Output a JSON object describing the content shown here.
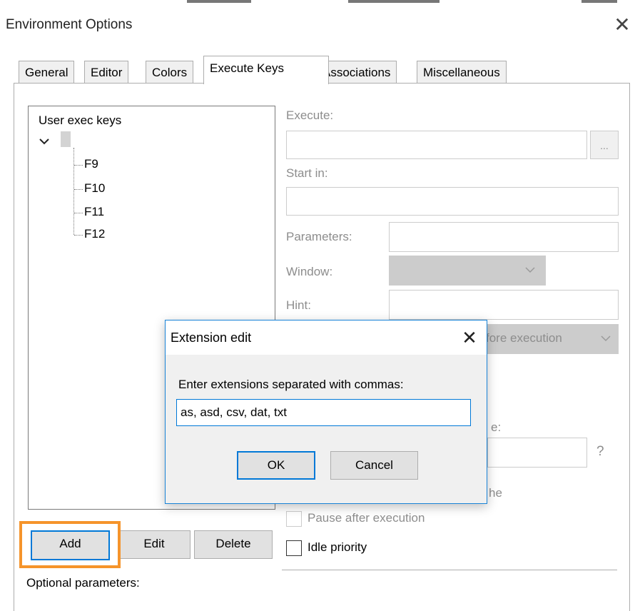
{
  "window": {
    "title": "Environment Options",
    "close_glyph": "✕"
  },
  "tabs": [
    {
      "label": "General",
      "active": false
    },
    {
      "label": "Editor",
      "active": false
    },
    {
      "label": "Colors",
      "active": false
    },
    {
      "label": "Execute Keys",
      "active": true
    },
    {
      "label": "Associations",
      "active": false
    },
    {
      "label": "Miscellaneous",
      "active": false
    }
  ],
  "tree": {
    "header": "User exec keys",
    "expander_icon": "chevron-down-icon",
    "root_label": "",
    "items": [
      "F9",
      "F10",
      "F11",
      "F12"
    ]
  },
  "execute_panel": {
    "execute_label": "Execute:",
    "browse_label": "...",
    "start_in_label": "Start in:",
    "parameters_label": "Parameters:",
    "window_label": "Window:",
    "hint_label": "Hint:",
    "behind_dialog_combo_text": "fore execution",
    "behind_dialog_label_2": "e:",
    "help_glyph": "?",
    "behind_dialog_label_3": "he",
    "pause_label": "Pause after execution",
    "idle_label": "Idle priority"
  },
  "buttons": {
    "add": "Add",
    "edit": "Edit",
    "delete": "Delete"
  },
  "optional_parameters_label": "Optional parameters:",
  "dialog": {
    "title": "Extension edit",
    "close_glyph": "✕",
    "prompt": "Enter extensions separated with commas:",
    "value": "as, asd, csv, dat, txt",
    "ok_label": "OK",
    "cancel_label": "Cancel"
  },
  "colors": {
    "focus_blue": "#0078d7",
    "highlight_orange": "#f5942b",
    "disabled_grey": "#8d8d8d"
  }
}
